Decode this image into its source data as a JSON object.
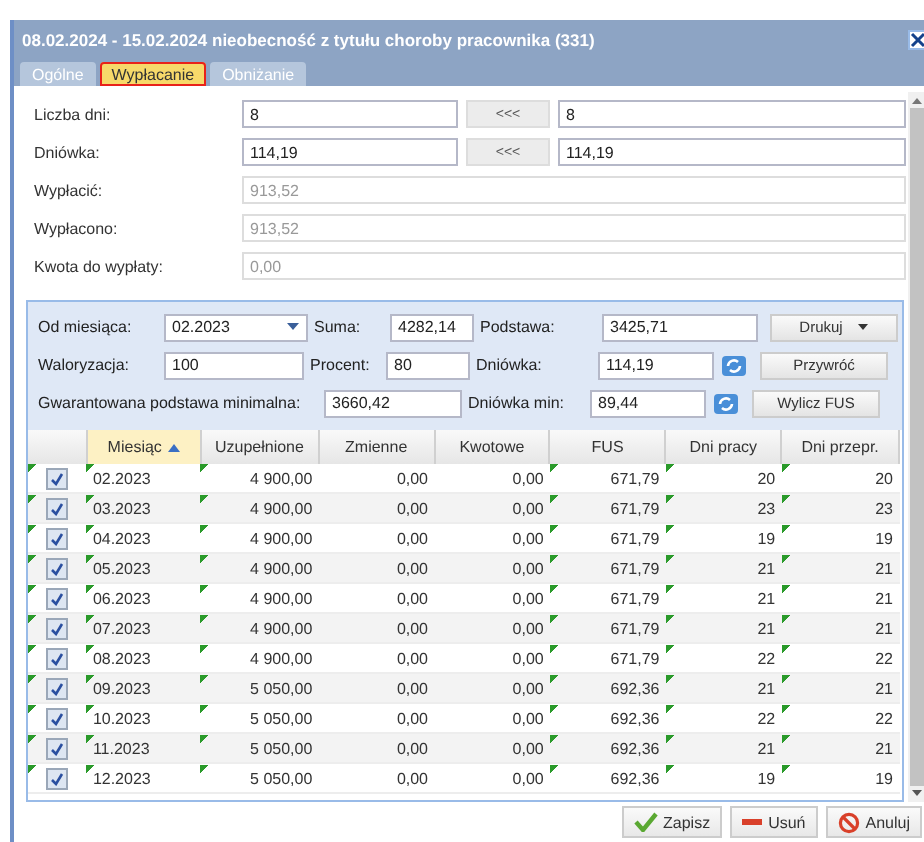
{
  "window": {
    "title": "08.02.2024 - 15.02.2024 nieobecność z tytułu choroby pracownika (331)"
  },
  "tabs": [
    {
      "label": "Ogólne",
      "selected": false
    },
    {
      "label": "Wypłacanie",
      "selected": true
    },
    {
      "label": "Obniżanie",
      "selected": false
    }
  ],
  "form": [
    {
      "kind": "copy",
      "label": "Liczba dni:",
      "value": "8",
      "button": "<<<",
      "value2": "8"
    },
    {
      "kind": "copy",
      "label": "Dniówka:",
      "value": "114,19",
      "button": "<<<",
      "value2": "114,19"
    },
    {
      "kind": "readonly",
      "label": "Wypłacić:",
      "value": "913,52",
      "disabled": true
    },
    {
      "kind": "readonly",
      "label": "Wypłacono:",
      "value": "913,52",
      "disabled": true
    },
    {
      "kind": "readonly",
      "label": "Kwota do wypłaty:",
      "value": "0,00",
      "disabled": true
    }
  ],
  "panel": {
    "od_miesiaca": {
      "label": "Od miesiąca:",
      "value": "02.2023"
    },
    "suma": {
      "label": "Suma:",
      "value": "4282,14"
    },
    "podstawa": {
      "label": "Podstawa:",
      "value": "3425,71"
    },
    "drukuj": "Drukuj",
    "waloryzacja": {
      "label": "Waloryzacja:",
      "value": "100"
    },
    "procent": {
      "label": "Procent:",
      "value": "80"
    },
    "dniowka": {
      "label": "Dniówka:",
      "value": "114,19"
    },
    "przywroc": "Przywróć",
    "gwarantowana": {
      "label": "Gwarantowana podstawa minimalna:",
      "value": "3660,42"
    },
    "dniowka_min": {
      "label": "Dniówka min:",
      "value": "89,44"
    },
    "wylicz": "Wylicz FUS"
  },
  "table": {
    "columns": [
      {
        "label": "Miesiąc",
        "sorted": true
      },
      {
        "label": "Uzupełnione",
        "sorted": false
      },
      {
        "label": "Zmienne",
        "sorted": false
      },
      {
        "label": "Kwotowe",
        "sorted": false
      },
      {
        "label": "FUS",
        "sorted": false
      },
      {
        "label": "Dni pracy",
        "sorted": false
      },
      {
        "label": "Dni przepr.",
        "sorted": false
      }
    ],
    "rows": [
      {
        "checked": true,
        "cells": [
          "02.2023",
          "4 900,00",
          "0,00",
          "0,00",
          "671,79",
          "20",
          "20"
        ]
      },
      {
        "checked": true,
        "cells": [
          "03.2023",
          "4 900,00",
          "0,00",
          "0,00",
          "671,79",
          "23",
          "23"
        ]
      },
      {
        "checked": true,
        "cells": [
          "04.2023",
          "4 900,00",
          "0,00",
          "0,00",
          "671,79",
          "19",
          "19"
        ]
      },
      {
        "checked": true,
        "cells": [
          "05.2023",
          "4 900,00",
          "0,00",
          "0,00",
          "671,79",
          "21",
          "21"
        ]
      },
      {
        "checked": true,
        "cells": [
          "06.2023",
          "4 900,00",
          "0,00",
          "0,00",
          "671,79",
          "21",
          "21"
        ]
      },
      {
        "checked": true,
        "cells": [
          "07.2023",
          "4 900,00",
          "0,00",
          "0,00",
          "671,79",
          "21",
          "21"
        ]
      },
      {
        "checked": true,
        "cells": [
          "08.2023",
          "4 900,00",
          "0,00",
          "0,00",
          "671,79",
          "22",
          "22"
        ]
      },
      {
        "checked": true,
        "cells": [
          "09.2023",
          "5 050,00",
          "0,00",
          "0,00",
          "692,36",
          "21",
          "21"
        ]
      },
      {
        "checked": true,
        "cells": [
          "10.2023",
          "5 050,00",
          "0,00",
          "0,00",
          "692,36",
          "22",
          "22"
        ]
      },
      {
        "checked": true,
        "cells": [
          "11.2023",
          "5 050,00",
          "0,00",
          "0,00",
          "692,36",
          "21",
          "21"
        ]
      },
      {
        "checked": true,
        "cells": [
          "12.2023",
          "5 050,00",
          "0,00",
          "0,00",
          "692,36",
          "19",
          "19"
        ]
      }
    ]
  },
  "buttons": [
    {
      "kind": "save",
      "label": "Zapisz"
    },
    {
      "kind": "delete",
      "label": "Usuń"
    },
    {
      "kind": "cancel",
      "label": "Anuluj"
    }
  ]
}
